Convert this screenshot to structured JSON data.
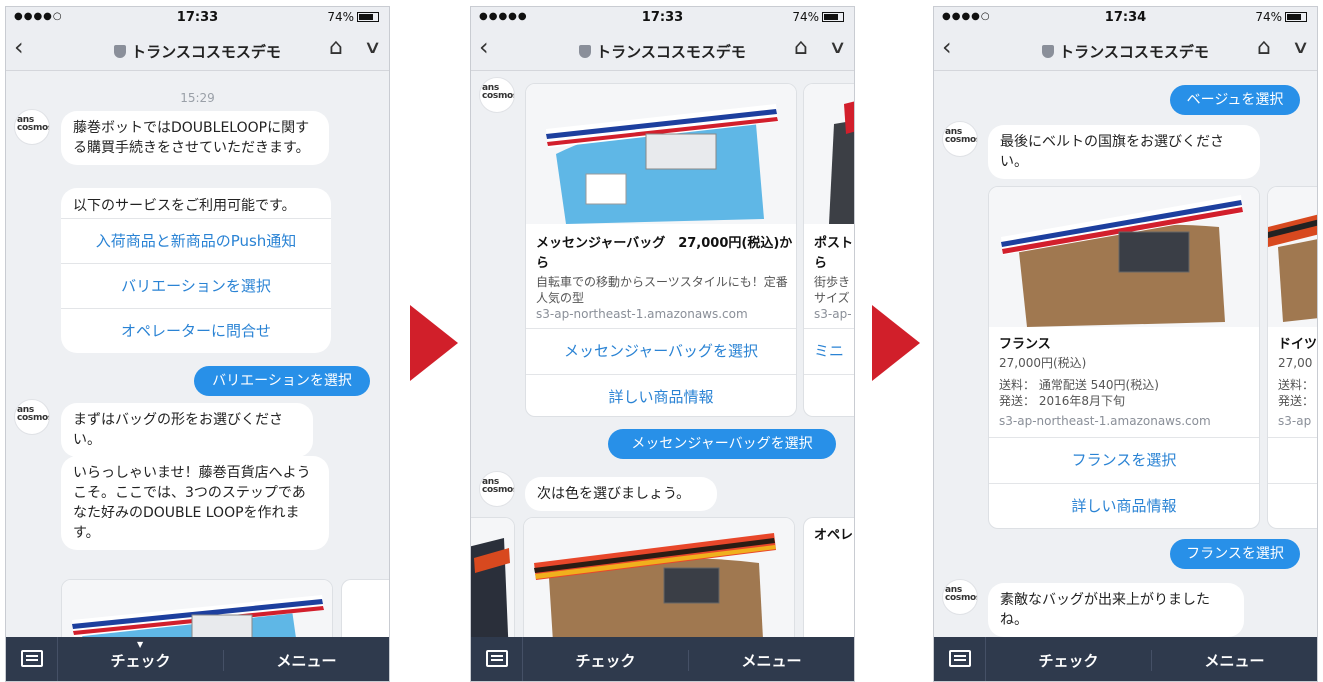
{
  "status": {
    "signal": "●●●●○",
    "signal_full": "●●●●●",
    "time1": "17:33",
    "time2": "17:33",
    "time3": "17:34",
    "battery": "74%"
  },
  "nav": {
    "title": "トランスコスモスデモ",
    "back": "‹",
    "home": "⌂",
    "chevron": "∨"
  },
  "bottom": {
    "check": "チェック",
    "menu": "メニュー"
  },
  "avatar_logo": "ans\ncosmos",
  "screen1": {
    "timestamp": "15:29",
    "bot1": "藤巻ボットではDOUBLELOOPに関する購買手続きをさせていただきます。",
    "bot2": "以下のサービスをご利用可能です。",
    "options": [
      "入荷商品と新商品のPush通知",
      "バリエーションを選択",
      "オペレーターに問合せ"
    ],
    "user1": "バリエーションを選択",
    "bot3": "まずはバッグの形をお選びください。",
    "bot4": "いらっしゃいませ！藤巻百貨店へようこそ。ここでは、3つのステップであなた好みのDOUBLE LOOPを作れます。"
  },
  "screen2": {
    "card1": {
      "title": "メッセンジャーバッグ　27,000円(税込)から",
      "desc": "自転車での移動からスーツスタイルにも！定番人気の型",
      "url": "s3-ap-northeast-1.amazonaws.com",
      "btn1": "メッセンジャーバッグを選択",
      "btn2": "詳しい商品情報"
    },
    "card2": {
      "title": "ポスト",
      "title2": "ら",
      "desc": "街歩き",
      "desc2": "サイズ",
      "url": "s3-ap-",
      "btn1": "ミニ"
    },
    "user1": "メッセンジャーバッグを選択",
    "bot1": "次は色を選びましょう。",
    "peek": "オペレ"
  },
  "screen3": {
    "user1": "ベージュを選択",
    "bot1": "最後にベルトの国旗をお選びください。",
    "card1": {
      "title": "フランス",
      "price": "27,000円(税込)",
      "ship": "送料：  通常配送 540円(税込)",
      "date": "発送：  2016年8月下旬",
      "url": "s3-ap-northeast-1.amazonaws.com",
      "btn1": "フランスを選択",
      "btn2": "詳しい商品情報"
    },
    "card2": {
      "title": "ドイツ",
      "price": "27,00",
      "ship": "送料：",
      "date": "発送：",
      "url": "s3-ap"
    },
    "user2": "フランスを選択",
    "bot2": "素敵なバッグが出来上がりましたね。"
  },
  "colors": {
    "accent": "#2890e8",
    "link": "#2a83d4",
    "bottom_bar": "#2f3a4d",
    "arrow": "#d11f2a"
  }
}
